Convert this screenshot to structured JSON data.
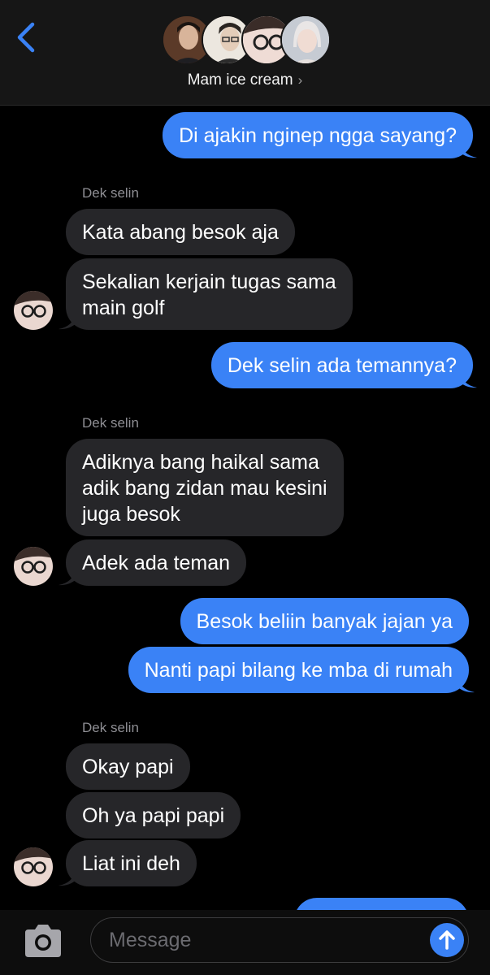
{
  "header": {
    "group_name": "Mam ice cream",
    "chevron": "›",
    "back_icon": "chevron-left-icon"
  },
  "messages": [
    {
      "direction": "outgoing",
      "text": "Di ajakin nginep ngga sayang?"
    },
    {
      "sender": "Dek selin"
    },
    {
      "direction": "incoming",
      "text": "Kata abang besok aja"
    },
    {
      "direction": "incoming",
      "text": "Sekalian kerjain tugas sama\nmain golf"
    },
    {
      "direction": "outgoing",
      "text": "Dek selin ada temannya?"
    },
    {
      "sender": "Dek selin"
    },
    {
      "direction": "incoming",
      "text": "Adiknya bang haikal sama\nadik bang zidan mau kesini\njuga besok"
    },
    {
      "direction": "incoming",
      "text": "Adek ada teman"
    },
    {
      "direction": "outgoing",
      "text": "Besok beliin banyak jajan ya"
    },
    {
      "direction": "outgoing",
      "text": "Nanti papi bilang ke mba di rumah"
    },
    {
      "sender": "Dek selin"
    },
    {
      "direction": "incoming",
      "text": "Okay papi"
    },
    {
      "direction": "incoming",
      "text": "Oh ya papi papi"
    },
    {
      "direction": "incoming",
      "text": "Liat ini deh"
    }
  ],
  "composer": {
    "placeholder": "Message",
    "camera_icon": "camera-icon",
    "send_icon": "send-arrow-up-icon"
  },
  "colors": {
    "outgoing_bubble": "#3a82f6",
    "incoming_bubble": "#262629",
    "background": "#000000",
    "accent": "#3a82f6"
  }
}
